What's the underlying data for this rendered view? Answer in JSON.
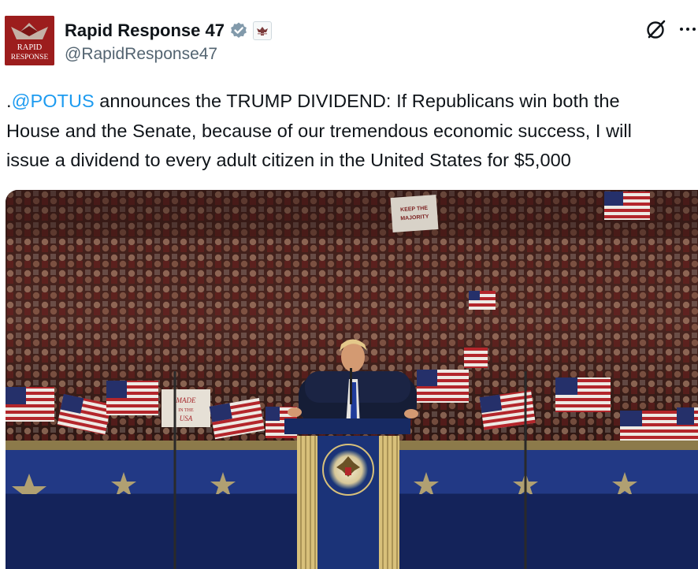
{
  "account": {
    "display_name": "Rapid Response 47",
    "handle": "@RapidResponse47",
    "avatar_text_line1": "RAPID",
    "avatar_text_line2": "RESPONSE",
    "verified": true,
    "affiliate_badge_icon": "seal-badge-icon"
  },
  "actions": {
    "grok_icon": "grok-slash-circle-icon",
    "more_icon": "more-dots-icon"
  },
  "tweet": {
    "mention": "@POTUS",
    "line1_prefix": ".",
    "line1_rest": " announces the TRUMP DIVIDEND: If Republicans win both the",
    "line2": "House and the Senate, because of our tremendous economic success, I will",
    "line3": "issue a dividend to every adult citizen in the United States for $5,000"
  },
  "media": {
    "signs": {
      "keep_the_majority": "KEEP THE MAJORITY",
      "made_in_usa": "MADE IN THE USA"
    }
  },
  "colors": {
    "link": "#1d9bf0",
    "secondary_text": "#536471",
    "verified": "#829aab",
    "avatar_bg": "#9c1d1d"
  }
}
